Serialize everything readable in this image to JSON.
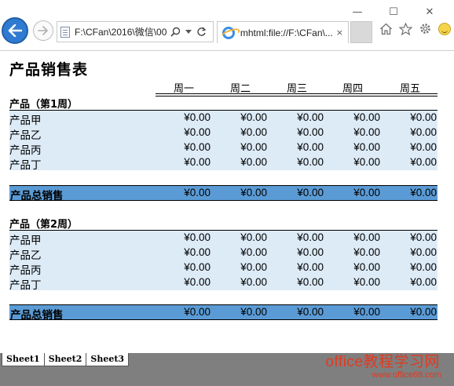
{
  "browser": {
    "url_text": "F:\\CFan\\2016\\微信\\00",
    "tab_title": "mhtml:file://F:\\CFan\\...",
    "tab_close": "×",
    "win_min": "—",
    "win_max": "☐",
    "win_close": "✕",
    "icons": [
      "back-arrow-icon",
      "forward-arrow-icon",
      "page-icon",
      "search-icon",
      "refresh-icon",
      "ie-icon",
      "home-icon",
      "star-icon",
      "gear-icon",
      "smiley-icon"
    ]
  },
  "sheet": {
    "title": "产品销售表",
    "days": [
      "周一",
      "周二",
      "周三",
      "周四",
      "周五"
    ],
    "sections": [
      {
        "label": "产品（第1周）",
        "rows": [
          {
            "name": "产品甲",
            "values": [
              "¥0.00",
              "¥0.00",
              "¥0.00",
              "¥0.00",
              "¥0.00"
            ]
          },
          {
            "name": "产品乙",
            "values": [
              "¥0.00",
              "¥0.00",
              "¥0.00",
              "¥0.00",
              "¥0.00"
            ]
          },
          {
            "name": "产品丙",
            "values": [
              "¥0.00",
              "¥0.00",
              "¥0.00",
              "¥0.00",
              "¥0.00"
            ]
          },
          {
            "name": "产品丁",
            "values": [
              "¥0.00",
              "¥0.00",
              "¥0.00",
              "¥0.00",
              "¥0.00"
            ]
          }
        ],
        "total": {
          "name": "产品总销售",
          "values": [
            "¥0.00",
            "¥0.00",
            "¥0.00",
            "¥0.00",
            "¥0.00"
          ]
        }
      },
      {
        "label": "产品（第2周）",
        "rows": [
          {
            "name": "产品甲",
            "values": [
              "¥0.00",
              "¥0.00",
              "¥0.00",
              "¥0.00",
              "¥0.00"
            ]
          },
          {
            "name": "产品乙",
            "values": [
              "¥0.00",
              "¥0.00",
              "¥0.00",
              "¥0.00",
              "¥0.00"
            ]
          },
          {
            "name": "产品丙",
            "values": [
              "¥0.00",
              "¥0.00",
              "¥0.00",
              "¥0.00",
              "¥0.00"
            ]
          },
          {
            "name": "产品丁",
            "values": [
              "¥0.00",
              "¥0.00",
              "¥0.00",
              "¥0.00",
              "¥0.00"
            ]
          }
        ],
        "total": {
          "name": "产品总销售",
          "values": [
            "¥0.00",
            "¥0.00",
            "¥0.00",
            "¥0.00",
            "¥0.00"
          ]
        }
      }
    ],
    "sheet_tabs": [
      "Sheet1",
      "Sheet2",
      "Sheet3"
    ]
  },
  "watermark": {
    "line1": "office教程学习网",
    "line2": "www.office68.com"
  },
  "colors": {
    "row_band": "#ddebf7",
    "total_band": "#5b9bd5",
    "tabs_bar": "#7f7f7f",
    "watermark": "#e23a20",
    "back_button": "#2f7bd1"
  }
}
